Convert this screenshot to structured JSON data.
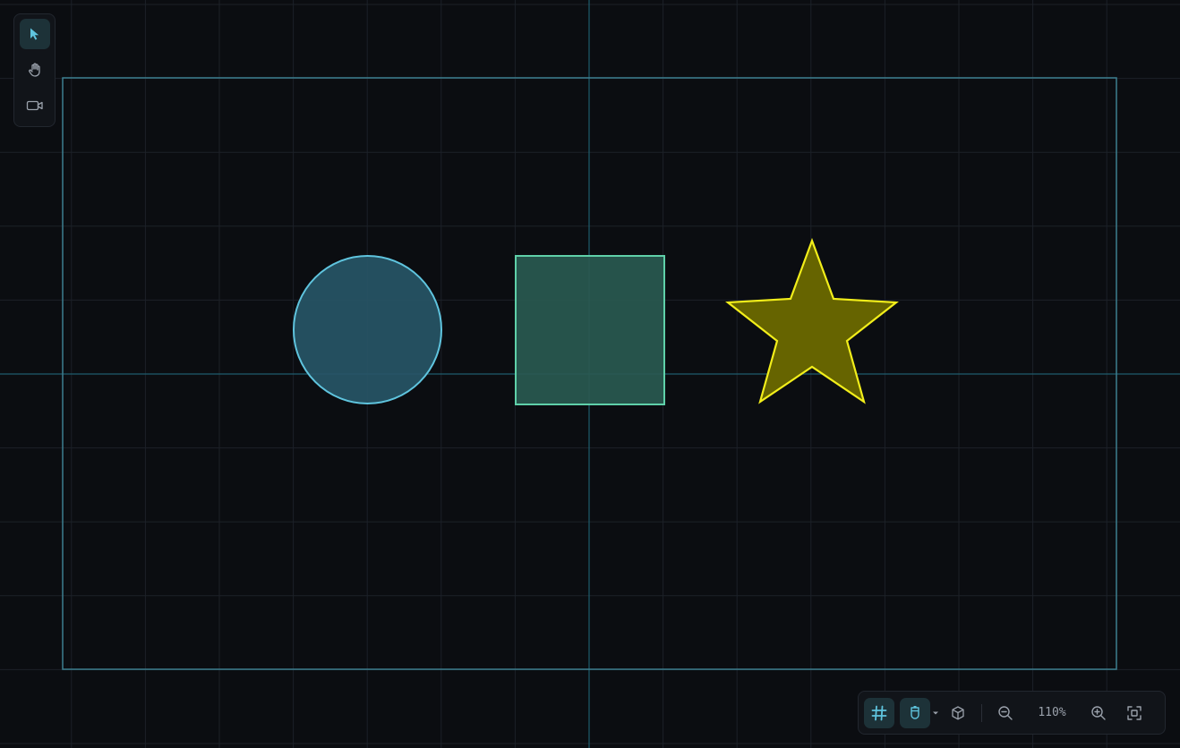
{
  "toolbar_left": {
    "tools": [
      {
        "name": "select",
        "icon": "cursor-arrow-icon",
        "active": true
      },
      {
        "name": "pan",
        "icon": "hand-icon",
        "active": false
      },
      {
        "name": "camera",
        "icon": "video-camera-icon",
        "active": false
      }
    ]
  },
  "view_toolbar": {
    "grid_toggle": {
      "icon": "grid-hash-icon",
      "active": true
    },
    "snap_toggle": {
      "icon": "magnet-icon",
      "active": true
    },
    "snap_dropdown": {
      "icon": "caret-down-icon"
    },
    "view_3d": {
      "icon": "cube-icon"
    },
    "zoom_out": {
      "icon": "zoom-out-icon"
    },
    "zoom_level": "110%",
    "zoom_in": {
      "icon": "zoom-in-icon"
    },
    "fit_view": {
      "icon": "fit-frame-icon"
    }
  },
  "canvas": {
    "background": "#0b0d11",
    "grid_color": "#1c2128",
    "axis_color": "#1f5d6d",
    "frame_color": "#3d7f8f",
    "shapes": [
      {
        "type": "circle",
        "fill": "#275566",
        "stroke": "#5fc4de"
      },
      {
        "type": "square",
        "fill": "#295950",
        "stroke": "#5fd0a9"
      },
      {
        "type": "star",
        "fill": "#666400",
        "stroke": "#f2ee1a"
      }
    ]
  }
}
